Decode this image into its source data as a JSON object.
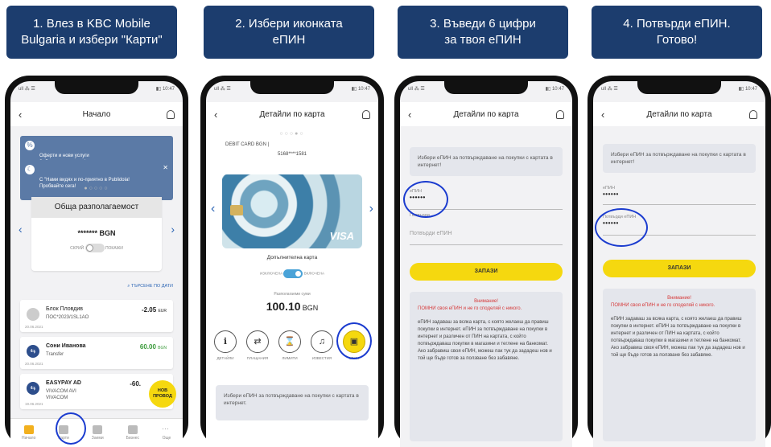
{
  "steps": [
    "1. Влез в KBC Mobile\nBulgaria и избери \"Карти\"",
    "2. Избери иконката\nеПИН",
    "3. Въведи 6 цифри\nза твоя еПИН",
    "4. Потвърди еПИН.\nГотово!"
  ],
  "status_bar": {
    "left": "ull ⁂ ☰",
    "right": "▮▯ 10:47"
  },
  "phone1": {
    "title": "Начало",
    "banner1": "Оферти и нови услуги\nЗабрави за лихвите!",
    "banner2": "С \"Нами видях и по-приятно в Publidola!\nПробвайте сега!",
    "balance_label": "Обща разполагаемост",
    "balance_value": "******* BGN",
    "toggle_off": "СКРИЙ",
    "toggle_on": "ПОКАЖИ",
    "search_link": "ТЪРСЕНЕ ПО ДАТИ",
    "transactions": [
      {
        "name": "Блок Пловдив",
        "sub": "ПОС*2023/1SL1AO",
        "date": "20.06.2021",
        "amount": "-2.05",
        "currency": "EUR"
      },
      {
        "name": "Сони Иванова",
        "sub": "Transfer",
        "date": "20.06.2021",
        "amount": "60.00",
        "currency": "BGN"
      },
      {
        "name": "EASYPAY AD",
        "sub": "VIVACOM AVI\nVIVACOM",
        "date": "19.06.2021",
        "amount": "-60.",
        "currency": ""
      }
    ],
    "badge": "НОВ ПРОВОД",
    "tabs": [
      "Начало",
      "Карти",
      "Заеми",
      "Бизнес",
      "Още"
    ]
  },
  "phone2": {
    "title": "Детайли по карта",
    "card_name": "DEBIT CARD BGN |",
    "card_number": "5168****1581",
    "card_brand": "VISA",
    "card_type": "Допълнителна карта",
    "toggle_off": "ИЗКЛЮЧЕНА",
    "toggle_on": "ВКЛЮЧЕНА",
    "available_label": "Разполагаеми суми",
    "available_amount": "100.10",
    "available_currency": "BGN",
    "actions": [
      "ДЕТАЙЛИ",
      "ПЛАЩАНИЯ",
      "ЛИМИТИ",
      "ИЗВЕСТИЯ",
      "еПИН"
    ],
    "info": "Избери еПИН за потвърждаване на покупки с картата в интернет."
  },
  "phone3": {
    "title": "Детайли по карта",
    "info": "Избери еПИН за потвърждаване на покупки с картата в интернет!",
    "pin_label": "еПИН",
    "pin_value": "••••••",
    "confirm_label": "Потвърди",
    "confirm_placeholder": "Потвърди еПИН",
    "save": "ЗАПАЗИ",
    "warn_title": "Внимание!",
    "warn_sub": "ПОМНИ своя еПИН и не го споделяй с никого.",
    "warn_body": "еПИН задаваш за всяка карта, с която желаеш да правиш покупки в интернет. еПИН за потвърждаване на покупки в интернет и различен от ПИН на картата, с който потвърждаваш покупки в магазини и теглене на банкомат. Ако забравиш своя еПИН, можеш пак тук да зададеш нов и той ще бъде готов за ползване без забавяне."
  },
  "phone4": {
    "title": "Детайли по карта",
    "info": "Избери еПИН за потвърждаване на покупки с картата в интернет!",
    "pin_label": "еПИН",
    "pin_value": "••••••",
    "confirm_label": "Потвърди еПИН",
    "confirm_value": "••••••",
    "save": "ЗАПАЗИ",
    "warn_title": "Внимание!",
    "warn_sub": "ПОМНИ своя еПИН и не го споделяй с никого.",
    "warn_body": "еПИН задаваш за всяка карта, с която желаеш да правиш покупки в интернет. еПИН за потвърждаване на покупки в интернет и различен от ПИН на картата, с който потвърждаваш покупки в магазини и теглене на банкомат. Ако забравиш своя еПИН, можеш пак тук да зададеш нов и той ще бъде готов за ползване без забавяне."
  }
}
